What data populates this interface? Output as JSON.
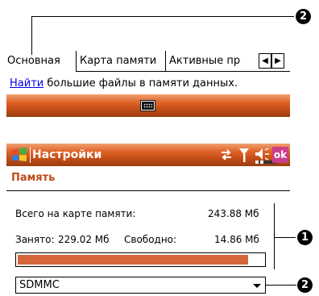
{
  "callouts": {
    "top": "2",
    "side": "1",
    "bottom": "2"
  },
  "tabs": [
    {
      "label": "Основная"
    },
    {
      "label": "Карта памяти"
    },
    {
      "label": "Активные пр"
    }
  ],
  "find_row": {
    "link": "Найти",
    "text": "большие файлы в памяти данных."
  },
  "title_bar": {
    "title": "Настройки",
    "ok_label": "ok"
  },
  "page": {
    "title": "Память"
  },
  "storage": {
    "total_label": "Всего на карте памяти:",
    "total_value": "243.88 Мб",
    "used_label": "Занято:",
    "used_value": "229.02 Мб",
    "free_label": "Свободно:",
    "free_value": "14.86 Мб",
    "used_fraction": 0.939
  },
  "card_select": {
    "value": "SDMMC"
  },
  "colors": {
    "accent": "#d5653a",
    "title_text": "#c24a17",
    "ok_button": "#cc3d8a",
    "link": "#0000ee"
  }
}
